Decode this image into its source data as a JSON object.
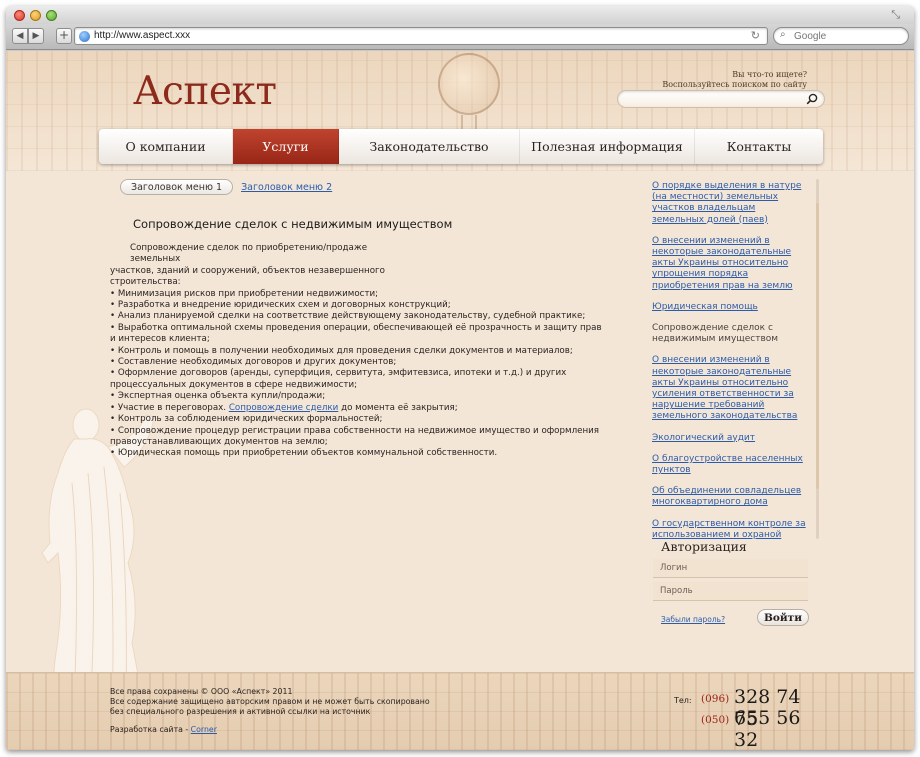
{
  "browser": {
    "url": "http://www.aspect.xxx",
    "search_placeholder": "Google"
  },
  "site": {
    "logo": "Аспект",
    "search_hint_line1": "Вы что-то ищете?",
    "search_hint_line2": "Воспользуйтесь поиском по сайту"
  },
  "nav": {
    "items": [
      {
        "label": "О компании"
      },
      {
        "label": "Услуги"
      },
      {
        "label": "Законодательство"
      },
      {
        "label": "Полезная информация"
      },
      {
        "label": "Контакты"
      }
    ],
    "active_index": 1
  },
  "submenu": {
    "pill": "Заголовок меню 1",
    "link": "Заголовок меню 2"
  },
  "article": {
    "title": "Сопровождение сделок с недвижимым имуществом",
    "intro": "Сопровождение сделок по приобретению/продаже земельных",
    "intro_cont": "участков, зданий и сооружений, объектов незавершенного строительства:",
    "bullets": [
      "• Минимизация рисков при приобретении недвижимости;",
      "• Разработка и внедрение юридических схем и договорных конструкций;",
      "• Анализ планируемой сделки на соответствие действующему законодательству, судебной практике;",
      "• Выработка оптимальной схемы проведения операции, обеспечивающей её прозрачность и защиту прав и интересов клиента;",
      "• Контроль и помощь в получении необходимых для проведения сделки документов и материалов;",
      "• Составление необходимых договоров и других документов;",
      "• Оформление договоров (аренды, суперфиция, сервитута, эмфитевзиса, ипотеки и т.д.) и других процессуальных документов в сфере недвижимости;",
      "• Экспертная оценка объекта купли/продажи;"
    ],
    "participation_prefix": "• Участие в переговорах.",
    "participation_link": "Сопровождение сделки",
    "participation_suffix": "до момента её закрытия;",
    "bullets_after": [
      "• Контроль за соблюдением юридических формальностей;",
      "• Сопровождение процедур регистрации права собственности на недвижимое имущество и оформления правоустанавливающих документов на землю;",
      "• Юридическая помощь при приобретении объектов коммунальной собственности."
    ]
  },
  "sidebar": {
    "news": [
      {
        "text": "О порядке выделения в натуре (на местности) земельных участков владельцам земельных долей (паев)",
        "link": true
      },
      {
        "text": "О внесении изменений в некоторые законодательные акты Украины относительно упрощения порядка приобретения прав на землю",
        "link": true
      },
      {
        "text": "Юридическая помощь",
        "link": true
      },
      {
        "text": "Сопровождение сделок с недвижимым имуществом",
        "link": false
      },
      {
        "text": "О внесении изменений в некоторые законодательные акты Украины относительно усиления ответственности за нарушение требований земельного законодательства",
        "link": true
      },
      {
        "text": "Экологический аудит",
        "link": true
      },
      {
        "text": "О благоустройстве населенных пунктов",
        "link": true
      },
      {
        "text": "Об объединении совладельцев многоквартирного дома",
        "link": true
      },
      {
        "text": "О государственном контроле за использованием и охраной",
        "link": true
      }
    ]
  },
  "auth": {
    "title": "Авторизация",
    "login_placeholder": "Логин",
    "password_placeholder": "Пароль",
    "forgot": "Забыли пароль?",
    "submit": "Войти"
  },
  "footer": {
    "copyright_line1": "Все права сохранены © ООО «Аспект» 2011",
    "copyright_line2": "Все содержание защищено авторским правом и не может быть скопировано",
    "copyright_line3": "без специального разрешения и активной ссылки на источник",
    "dev_prefix": "Разработка сайта -",
    "dev_link": "Corner",
    "tel_label": "Тел:",
    "phone1_code": "(096)",
    "phone1_number": "328 74 75",
    "phone2_code": "(050)",
    "phone2_number": "655 56 32"
  },
  "colors": {
    "brand": "#8c2a1c",
    "nav_active": "#b03a26",
    "link": "#2b5cab",
    "page_bg": "#f4e6d6"
  }
}
